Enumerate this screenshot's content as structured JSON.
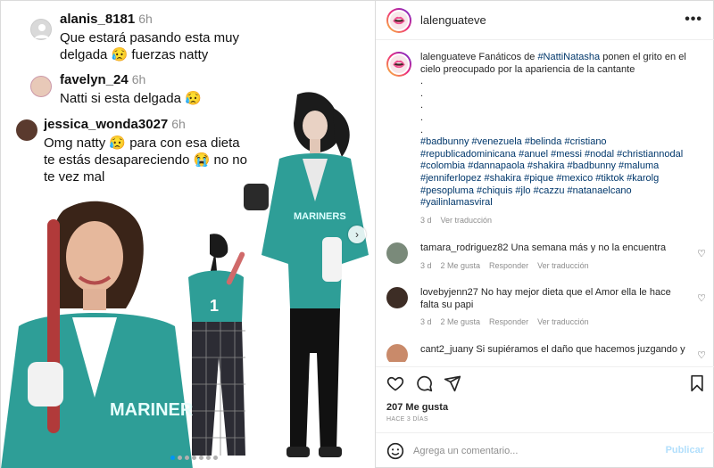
{
  "media": {
    "comments": [
      {
        "user": "alanis_8181",
        "time": "6h",
        "text": "Que estará pasando esta muy delgada 😥 fuerzas natty"
      },
      {
        "user": "favelyn_24",
        "time": "6h",
        "text": "Natti si esta delgada 😥"
      },
      {
        "user": "jessica_wonda3027",
        "time": "6h",
        "text": "Omg natty 😥 para con esa dieta te estás desapareciendo 😭 no no te vez mal"
      }
    ],
    "jersey_text": "MARINERS",
    "jersey_number": "1",
    "carousel_next": "›"
  },
  "header": {
    "username": "lalenguateve",
    "more": "•••"
  },
  "caption": {
    "username": "lalenguateve",
    "text_before": "Fanáticos de ",
    "mention": "#NattiNatasha",
    "text_after": " ponen el grito en el cielo preocupado por la apariencia de la cantante",
    "dots": [
      ".",
      ".",
      ".",
      ".",
      "."
    ],
    "hashtags": "#badbunny #venezuela #belinda #cristiano #republicadominicana #anuel #messi #nodal #christiannodal #colombia #dannapaola #shakira #badbunny #maluma #jenniferlopez #shakira #pique #mexico #tiktok #karolg #pesopluma #chiquis #jlo #cazzu #natanaelcano #yailinlamasviral",
    "age": "3 d",
    "translate": "Ver traducción"
  },
  "comments": [
    {
      "user": "tamara_rodriguez82",
      "text": "Una semana más y no la encuentra",
      "age": "3 d",
      "likes": "2 Me gusta",
      "reply": "Responder",
      "translate": "Ver traducción"
    },
    {
      "user": "lovebyjenn27",
      "text": "No hay mejor dieta que el Amor ella le hace falta su papi",
      "age": "3 d",
      "likes": "2 Me gusta",
      "reply": "Responder",
      "translate": "Ver traducción"
    },
    {
      "user": "cant2_juany",
      "text": "Si supiéramos el daño que hacemos juzgando y",
      "age": "",
      "likes": "",
      "reply": "",
      "translate": ""
    }
  ],
  "stats": {
    "likes": "207 Me gusta",
    "date": "HACE 3 DÍAS"
  },
  "add_comment": {
    "placeholder": "Agrega un comentario...",
    "publish": "Publicar"
  },
  "colors": {
    "hashtag": "#00376b",
    "muted": "#8e8e8e",
    "jersey_teal": "#2e9e97",
    "publish_disabled": "#b2dffc"
  }
}
